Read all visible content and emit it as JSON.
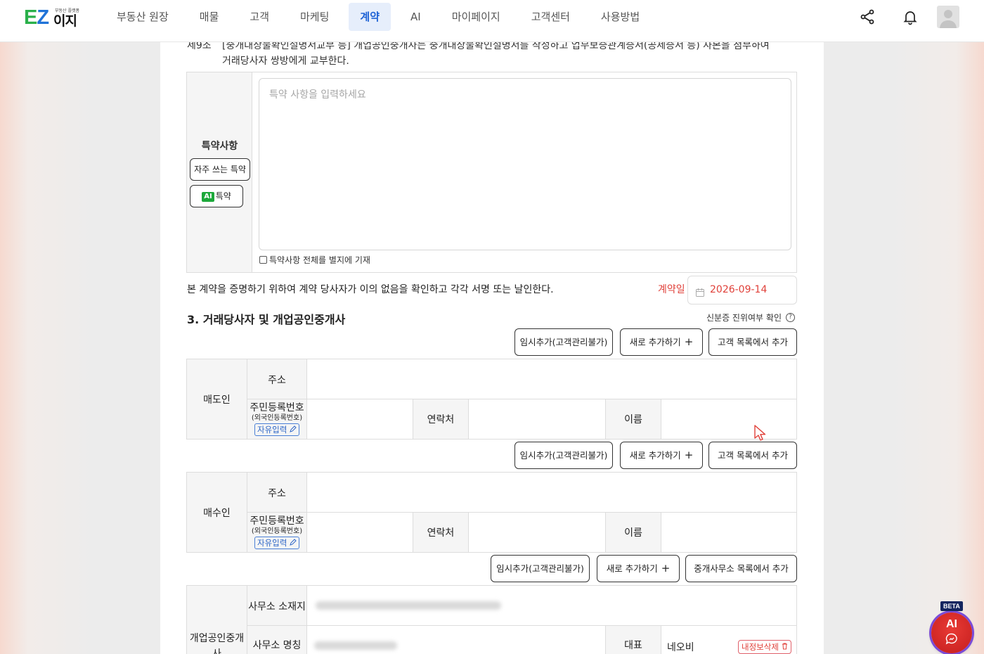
{
  "header": {
    "logo_ez": "EZ",
    "logo_ij": "이지",
    "logo_tag": "부동산 플랫폼",
    "nav": [
      {
        "label": "부동산 원장",
        "active": false
      },
      {
        "label": "매물",
        "active": false
      },
      {
        "label": "고객",
        "active": false
      },
      {
        "label": "마케팅",
        "active": false
      },
      {
        "label": "계약",
        "active": true
      },
      {
        "label": "AI",
        "active": false
      },
      {
        "label": "마이페이지",
        "active": false
      },
      {
        "label": "고객센터",
        "active": false
      },
      {
        "label": "사용방법",
        "active": false
      }
    ]
  },
  "article": {
    "num": "제9조",
    "text": "[중개대상물확인설명서교부 등] 개업공인중개사는 중개대상물확인설명서를 작성하고 업무보증관계증서(공제증서 등) 사본을 첨부하여 거래당사자 쌍방에게 교부한다."
  },
  "special": {
    "title": "특약사항",
    "frequent_btn": "자주 쓰는 특약",
    "ai_badge": "AI",
    "ai_btn": "특약",
    "placeholder": "특약 사항을 입력하세요",
    "separate_label": "특약사항 전체를 별지에 기재"
  },
  "confirm_text": "본 계약을 증명하기 위하여 계약 당사자가 이의 없음을 확인하고 각각 서명 또는 날인한다.",
  "contract_date": {
    "label": "계약일",
    "value": "2026-09-14"
  },
  "section3": {
    "title": "3. 거래당사자 및 개업공인중개사",
    "id_check": "신분증 진위여부 확인",
    "help": "?"
  },
  "buttons": {
    "temp_add": "임시추가(고객관리불가)",
    "new_add": "새로 추가하기",
    "plus": "+",
    "from_customers": "고객 목록에서 추가",
    "from_offices": "중개사무소 목록에서 추가"
  },
  "seller": {
    "role": "매도인",
    "address": "주소",
    "rrn": "주민등록번호",
    "rrn_sub": "(외국인등록번호)",
    "free_input": "자유입력",
    "contact": "연락처",
    "name": "이름"
  },
  "buyer": {
    "role": "매수인",
    "address": "주소",
    "rrn": "주민등록번호",
    "rrn_sub": "(외국인등록번호)",
    "free_input": "자유입력",
    "contact": "연락처",
    "name": "이름"
  },
  "agent": {
    "role": "개업공인중개사",
    "office_address": "사무소 소재지",
    "office_name": "사무소 명칭",
    "rep": "대표",
    "rep_name": "네오비",
    "delete_stamp": "내정보삭제"
  },
  "ai_fab": {
    "label": "AI",
    "beta": "BETA"
  }
}
